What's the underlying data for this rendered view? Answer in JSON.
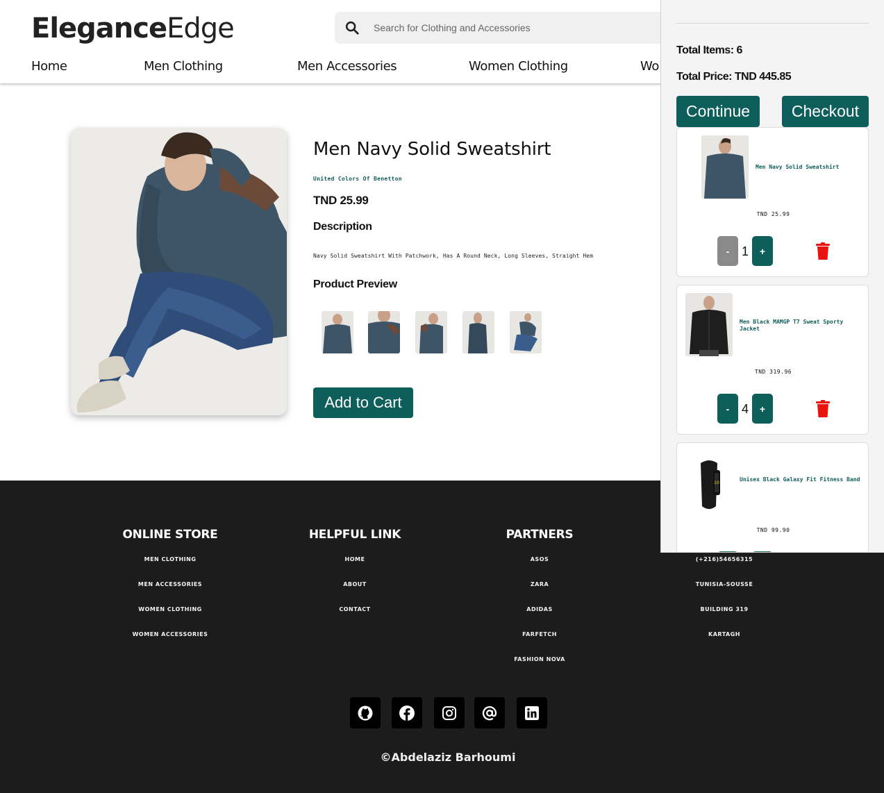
{
  "brand": {
    "name_bold": "Elegance",
    "name_light": "Edge"
  },
  "search": {
    "placeholder": "Search for Clothing and Accessories"
  },
  "nav": [
    "Home",
    "Men Clothing",
    "Men Accessories",
    "Women Clothing",
    "Wo"
  ],
  "product": {
    "title": "Men Navy Solid Sweatshirt",
    "brand": "United Colors Of Benetton",
    "price": "TND 25.99",
    "description_heading": "Description",
    "description": "Navy Solid Sweatshirt With Patchwork, Has A Round Neck, Long Sleeves, Straight Hem",
    "preview_heading": "Product Preview",
    "add_to_cart": "Add to Cart"
  },
  "cart": {
    "total_items": "Total Items: 6",
    "total_price": "Total Price: TND 445.85",
    "continue_label": "Continue",
    "checkout_label": "Checkout",
    "items": [
      {
        "name": "Men Navy Solid Sweatshirt",
        "price": "TND 25.99",
        "qty": "1",
        "minus_enabled": false
      },
      {
        "name": "Men Black MAMGP T7 Sweat Sporty Jacket",
        "price": "TND 319.96",
        "qty": "4",
        "minus_enabled": true
      },
      {
        "name": "Unisex Black Galaxy Fit Fitness Band",
        "price": "TND 99.90",
        "qty": "",
        "minus_enabled": true
      }
    ],
    "minus_label": "-",
    "plus_label": "+"
  },
  "footer": {
    "columns": [
      {
        "heading": "ONLINE STORE",
        "links": [
          "MEN CLOTHING",
          "MEN ACCESSORIES",
          "WOMEN CLOTHING",
          "WOMEN ACCESSORIES"
        ]
      },
      {
        "heading": "HELPFUL LINK",
        "links": [
          "HOME",
          "ABOUT",
          "CONTACT"
        ]
      },
      {
        "heading": "PARTNERS",
        "links": [
          "ASOS",
          "ZARA",
          "ADIDAS",
          "FARFETCH",
          "FASHION NOVA"
        ]
      },
      {
        "heading": "",
        "links": [
          "(+216)54656315",
          "TUNISIA-SOUSSE",
          "BUILDING 319",
          "KARTAGH"
        ]
      }
    ],
    "socials": [
      "github-icon",
      "facebook-icon",
      "instagram-icon",
      "email-at-icon",
      "linkedin-icon"
    ],
    "copyright": "©Abdelaziz Barhoumi"
  },
  "colors": {
    "accent": "#0e5e5b",
    "footer_bg": "#1c1c1c",
    "minus_disabled": "#8a8a8a",
    "trash": "#e8140f"
  }
}
